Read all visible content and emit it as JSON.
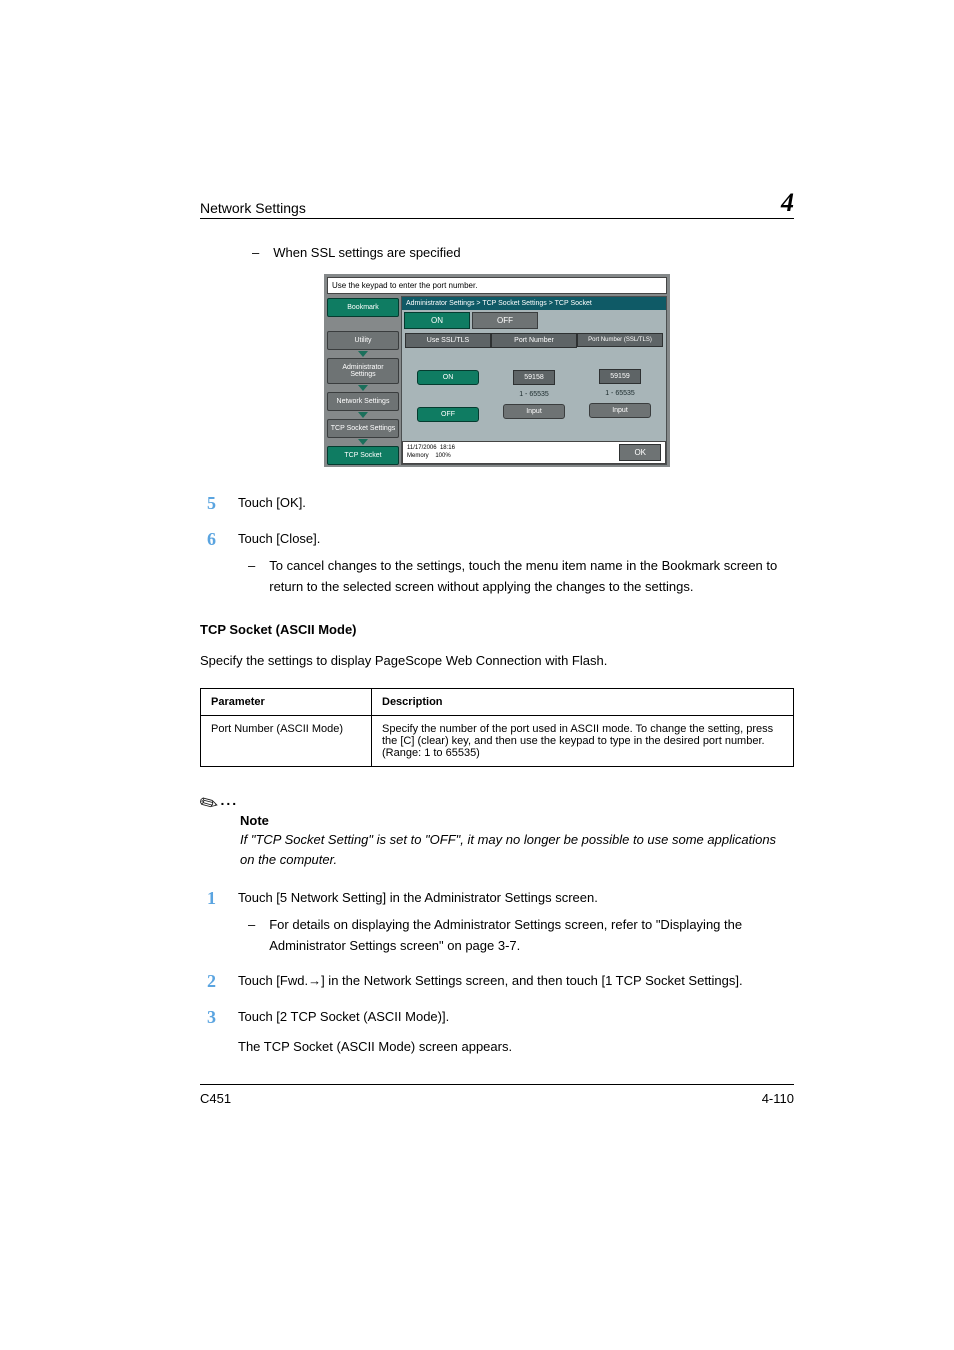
{
  "header": {
    "title": "Network Settings",
    "chapter_number": "4"
  },
  "intro": {
    "dash_text": "When SSL settings are specified"
  },
  "device": {
    "prompt": "Use the keypad to enter the port number.",
    "crumbs": [
      "Bookmark",
      "Utility",
      "Administrator Settings",
      "Network Settings",
      "TCP Socket Settings",
      "TCP Socket"
    ],
    "breadcrumb_line": "Administrator Settings > TCP Socket Settings > TCP Socket",
    "tab_on": "ON",
    "tab_off": "OFF",
    "col1_head": "Use SSL/TLS",
    "col1_on": "ON",
    "col1_off": "OFF",
    "col2_head": "Port Number",
    "col2_val": "59158",
    "col2_range": "1  -  65535",
    "col2_btn": "Input",
    "col3_head": "Port Number (SSL/TLS)",
    "col3_val": "59159",
    "col3_range": "1  -  65535",
    "col3_btn": "Input",
    "status_date": "11/17/2006",
    "status_time": "18:16",
    "status_mem_label": "Memory",
    "status_mem_val": "100%",
    "ok": "OK"
  },
  "steps_a": {
    "s5": {
      "num": "5",
      "text": "Touch [OK]."
    },
    "s6": {
      "num": "6",
      "text": "Touch [Close].",
      "sub": "To cancel changes to the settings, touch the menu item name in the Bookmark screen to return to the selected screen without applying the changes to the settings."
    }
  },
  "section2": {
    "title": "TCP Socket (ASCII Mode)",
    "lead": "Specify the settings to display PageScope Web Connection with Flash.",
    "th1": "Parameter",
    "th2": "Description",
    "row1_p": "Port Number (ASCII Mode)",
    "row1_d": "Specify the number of the port used in ASCII mode. To change the setting, press the [C] (clear) key, and then use the keypad to type in the desired port number. (Range: 1 to 65535)"
  },
  "note": {
    "label": "Note",
    "text": "If \"TCP Socket Setting\" is set to \"OFF\", it may no longer be possible to use some applications on the computer."
  },
  "steps_b": {
    "s1": {
      "num": "1",
      "text": "Touch [5 Network Setting] in the Administrator Settings screen.",
      "sub": "For details on displaying the Administrator Settings screen, refer to \"Displaying the Administrator Settings screen\" on page 3-7."
    },
    "s2": {
      "num": "2",
      "text": "Touch [Fwd.→] in the Network Settings screen, and then touch [1 TCP Socket Settings]."
    },
    "s3": {
      "num": "3",
      "text": "Touch [2 TCP Socket (ASCII Mode)].",
      "text2": "The TCP Socket (ASCII Mode) screen appears."
    }
  },
  "footer": {
    "left": "C451",
    "right": "4-110"
  }
}
